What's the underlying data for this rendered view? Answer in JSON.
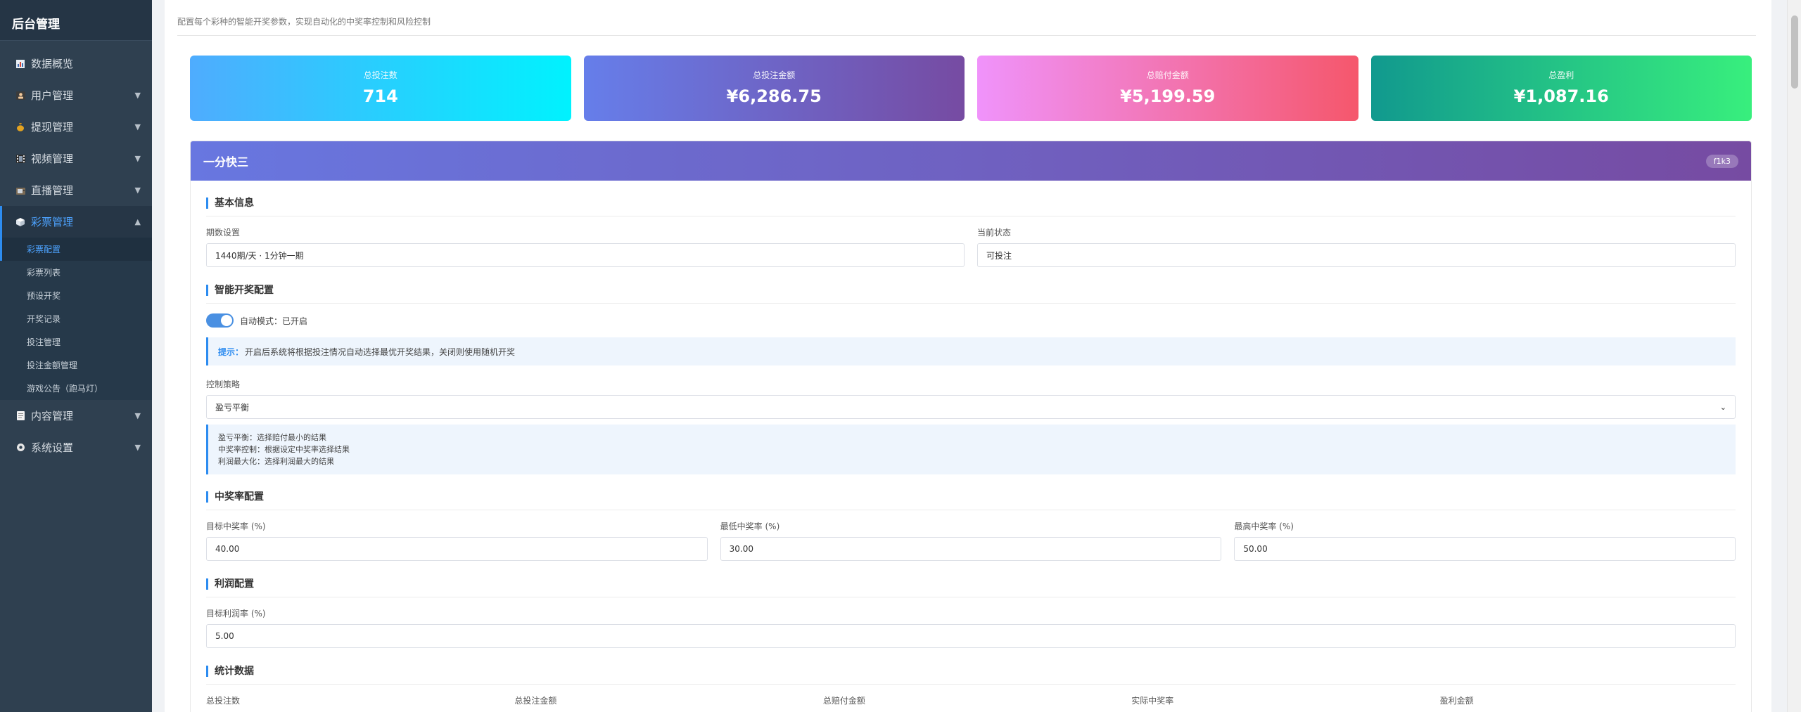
{
  "sidebar": {
    "brand": "后台管理",
    "items": [
      {
        "label": "数据概览",
        "icon": "chart-icon",
        "expandable": false
      },
      {
        "label": "用户管理",
        "icon": "user-icon",
        "expandable": true
      },
      {
        "label": "提现管理",
        "icon": "money-bag-icon",
        "expandable": true
      },
      {
        "label": "视频管理",
        "icon": "film-icon",
        "expandable": true
      },
      {
        "label": "直播管理",
        "icon": "tv-icon",
        "expandable": true
      },
      {
        "label": "彩票管理",
        "icon": "cube-icon",
        "expandable": true,
        "active": true
      },
      {
        "label": "内容管理",
        "icon": "document-icon",
        "expandable": true
      },
      {
        "label": "系统设置",
        "icon": "gear-icon",
        "expandable": true
      }
    ],
    "lottery_submenu": [
      "彩票配置",
      "彩票列表",
      "预设开奖",
      "开奖记录",
      "投注管理",
      "投注金额管理",
      "游戏公告（跑马灯）"
    ]
  },
  "header": {
    "subtitle": "配置每个彩种的智能开奖参数，实现自动化的中奖率控制和风险控制"
  },
  "stats": [
    {
      "label": "总投注数",
      "value": "714",
      "gradient": [
        "#4facfe",
        "#00f2fe"
      ]
    },
    {
      "label": "总投注金额",
      "value": "¥6,286.75",
      "gradient": [
        "#667eea",
        "#764ba2"
      ]
    },
    {
      "label": "总赔付金额",
      "value": "¥5,199.59",
      "gradient": [
        "#f093fb",
        "#f5576c"
      ]
    },
    {
      "label": "总盈利",
      "value": "¥1,087.16",
      "gradient": [
        "#11998e",
        "#38ef7d"
      ]
    }
  ],
  "lottery": {
    "name": "一分快三",
    "code": "f1k3",
    "basic": {
      "title": "基本信息",
      "period_label": "期数设置",
      "period_value": "1440期/天 · 1分钟一期",
      "status_label": "当前状态",
      "status_value": "可投注"
    },
    "smart": {
      "title": "智能开奖配置",
      "toggle_label": "自动模式：已开启",
      "tip_key": "提示：",
      "tip_text": "开启后系统将根据投注情况自动选择最优开奖结果，关闭则使用随机开奖",
      "strategy_label": "控制策略",
      "strategy_value": "盈亏平衡",
      "strategy_notes": [
        "盈亏平衡：选择赔付最小的结果",
        "中奖率控制：根据设定中奖率选择结果",
        "利润最大化：选择利润最大的结果"
      ]
    },
    "winrate": {
      "title": "中奖率配置",
      "target_label": "目标中奖率 (%)",
      "target_value": "40.00",
      "min_label": "最低中奖率 (%)",
      "min_value": "30.00",
      "max_label": "最高中奖率 (%)",
      "max_value": "50.00"
    },
    "profit": {
      "title": "利润配置",
      "target_label": "目标利润率 (%)",
      "target_value": "5.00"
    },
    "statistics": {
      "title": "统计数据",
      "columns": [
        "总投注数",
        "总投注金额",
        "总赔付金额",
        "实际中奖率",
        "盈利金额"
      ]
    }
  }
}
